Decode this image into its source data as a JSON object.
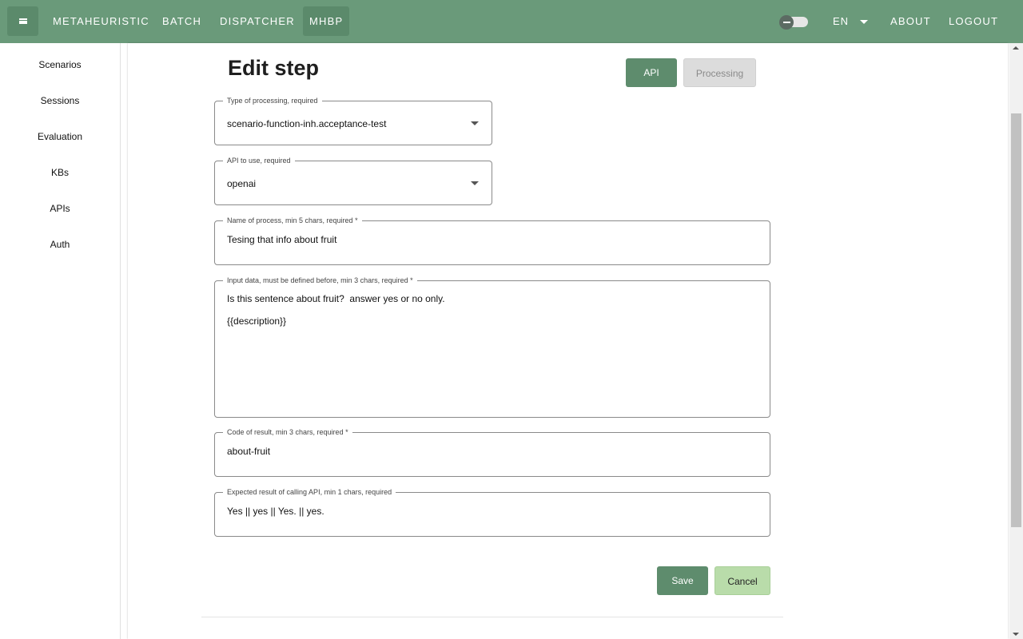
{
  "topbar": {
    "nav": [
      {
        "label": "METAHEURISTIC"
      },
      {
        "label": "BATCH"
      },
      {
        "label": "DISPATCHER"
      },
      {
        "label": "MHBP"
      }
    ],
    "language": "EN",
    "about": "ABOUT",
    "logout": "LOGOUT",
    "color": "#6a9a7a"
  },
  "sidebar": {
    "items": [
      {
        "label": "Scenarios"
      },
      {
        "label": "Sessions"
      },
      {
        "label": "Evaluation"
      },
      {
        "label": "KBs"
      },
      {
        "label": "APIs"
      },
      {
        "label": "Auth"
      }
    ]
  },
  "main": {
    "title": "Edit step",
    "tabs": {
      "api": "API",
      "processing": "Processing"
    },
    "fields": {
      "processing_type": {
        "label": "Type of processing, required",
        "value": "scenario-function-inh.acceptance-test"
      },
      "api": {
        "label": "API to use, required",
        "value": "openai"
      },
      "process_name": {
        "label": "Name of process, min 5 chars, required *",
        "value": "Tesing that info about fruit"
      },
      "input_data": {
        "label": "Input data, must be defined before, min 3 chars, required *",
        "value": "Is this sentence about fruit?  answer yes or no only.\n\n{{description}}"
      },
      "result_code": {
        "label": "Code of result, min 3 chars, required *",
        "value": "about-fruit"
      },
      "expected_result": {
        "label": "Expected result of calling API, min 1 chars, required",
        "value": "Yes || yes || Yes. || yes."
      }
    },
    "buttons": {
      "save": "Save",
      "cancel": "Cancel"
    },
    "accent": "#5e8c6d"
  }
}
